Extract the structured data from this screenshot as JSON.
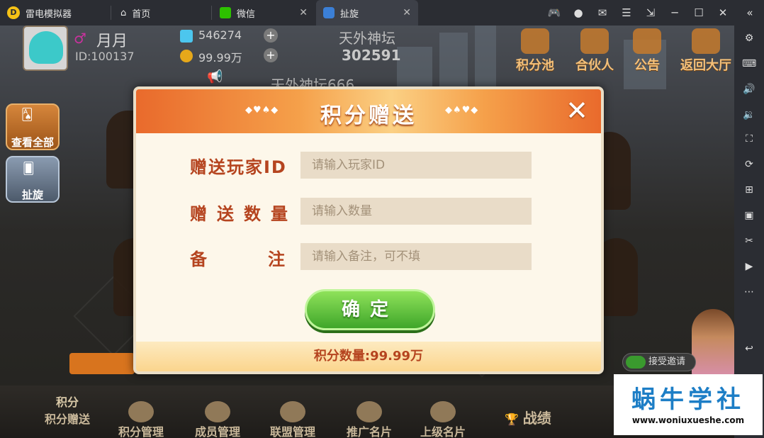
{
  "emulator": {
    "app_name": "雷电模拟器",
    "tabs": [
      {
        "label": "首页"
      },
      {
        "label": "微信"
      },
      {
        "label": "扯旋"
      }
    ]
  },
  "player": {
    "name": "月月",
    "id_text": "ID:100137",
    "diamonds": "546274",
    "gold": "99.99万"
  },
  "room": {
    "name": "天外神坛",
    "number": "302591",
    "banner": "天外神坛666"
  },
  "top_buttons": {
    "points_pool": "积分池",
    "partner": "合伙人",
    "notice": "公告",
    "back_hall": "返回大厅"
  },
  "side": {
    "view_all": "查看全部",
    "game": "扯旋"
  },
  "dialog": {
    "title": "积分赠送",
    "ornament_left": "◆♥♠◆",
    "ornament_right": "◆♠♥◆",
    "label_player_id": "赠送玩家ID",
    "placeholder_player_id": "请输入玩家ID",
    "label_amount": "赠送数量",
    "placeholder_amount": "请输入数量",
    "label_note": "备注",
    "placeholder_note": "请输入备注，可不填",
    "confirm": "确定",
    "points_text": "积分数量:99.99万"
  },
  "bottom_nav": {
    "gift_points_top": "积分",
    "gift_points": "积分赠送",
    "points_mgmt": "积分管理",
    "member_mgmt": "成员管理",
    "alliance_mgmt": "联盟管理",
    "promo_card": "推广名片",
    "superior_card": "上级名片",
    "record": "战绩"
  },
  "invite": {
    "label": "接受邀请"
  },
  "watermark": {
    "title": "蜗牛学社",
    "url": "www.woniuxueshe.com"
  },
  "colors": {
    "accent_orange": "#e96a2c",
    "label_red": "#b5441f",
    "confirm_green": "#3fa62a"
  }
}
